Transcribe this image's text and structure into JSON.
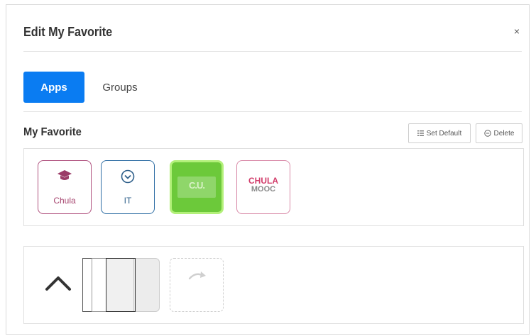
{
  "modal": {
    "title": "Edit My Favorite",
    "close_glyph": "×"
  },
  "tabs": [
    {
      "label": "Apps",
      "active": true
    },
    {
      "label": "Groups",
      "active": false
    }
  ],
  "favorites": {
    "title": "My Favorite",
    "set_default_label": "Set Default",
    "set_default_icon": "list-icon",
    "delete_label": "Delete",
    "delete_icon": "minus-circle-icon",
    "apps": [
      {
        "label": "Chula",
        "icon": "graduation-cap-icon",
        "color": "#b0527f"
      },
      {
        "label": "IT",
        "icon": "chevron-circle-down-icon",
        "color": "#2e6da4"
      },
      {
        "label": "",
        "icon": "cu-logo",
        "logo_text": "C.U.",
        "color": "#6cc93a"
      },
      {
        "label": "",
        "icon": "chula-mooc-logo",
        "logo_line1": "CHULA",
        "logo_line2": "MOOC",
        "color": "#d23d6b"
      }
    ]
  },
  "recent": {
    "collapse_icon": "chevron-up-icon",
    "placeholder_icon": "redo-icon"
  },
  "colors": {
    "accent": "#0a7cf2",
    "border": "#e0e0e0"
  }
}
